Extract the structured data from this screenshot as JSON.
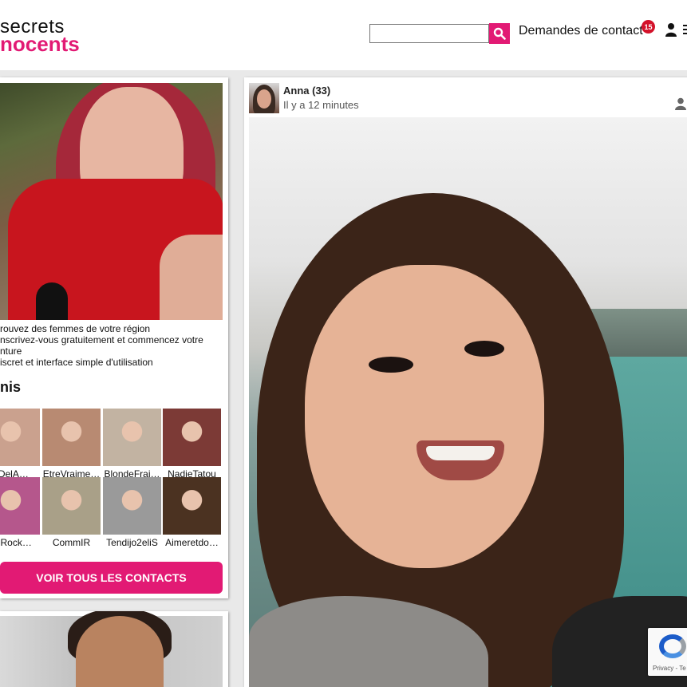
{
  "header": {
    "logo_line1": "secrets",
    "logo_line2": "nocents",
    "search_placeholder": "",
    "contact_requests_label": "Demandes de contact",
    "contact_requests_count": "15"
  },
  "sidebar": {
    "features": [
      "rouvez des femmes de votre région",
      "nscrivez-vous gratuitement et commencez votre",
      "nture",
      "iscret et interface simple d'utilisation"
    ],
    "section_title": "nis",
    "members": [
      {
        "name": "eDelA…",
        "color": "#caa18e"
      },
      {
        "name": "EtreVraime…",
        "color": "#b88a72"
      },
      {
        "name": "BlondeFrai…",
        "color": "#c2b3a2"
      },
      {
        "name": "NadieTatou",
        "color": "#7c3a36"
      },
      {
        "name": "ouRock…",
        "color": "#b5578c"
      },
      {
        "name": "CommIR",
        "color": "#a9a088"
      },
      {
        "name": "Tendijo2eliS",
        "color": "#9a9a9a"
      },
      {
        "name": "Aimeretdo…",
        "color": "#4b3221"
      }
    ],
    "view_all_button": "VOIR TOUS LES CONTACTS"
  },
  "post": {
    "author": "Anna (33)",
    "time": "Il y a 12 minutes"
  },
  "recaptcha": {
    "text": "Privacy - Te"
  },
  "colors": {
    "brand": "#e21a74",
    "badge": "#d3122a"
  }
}
